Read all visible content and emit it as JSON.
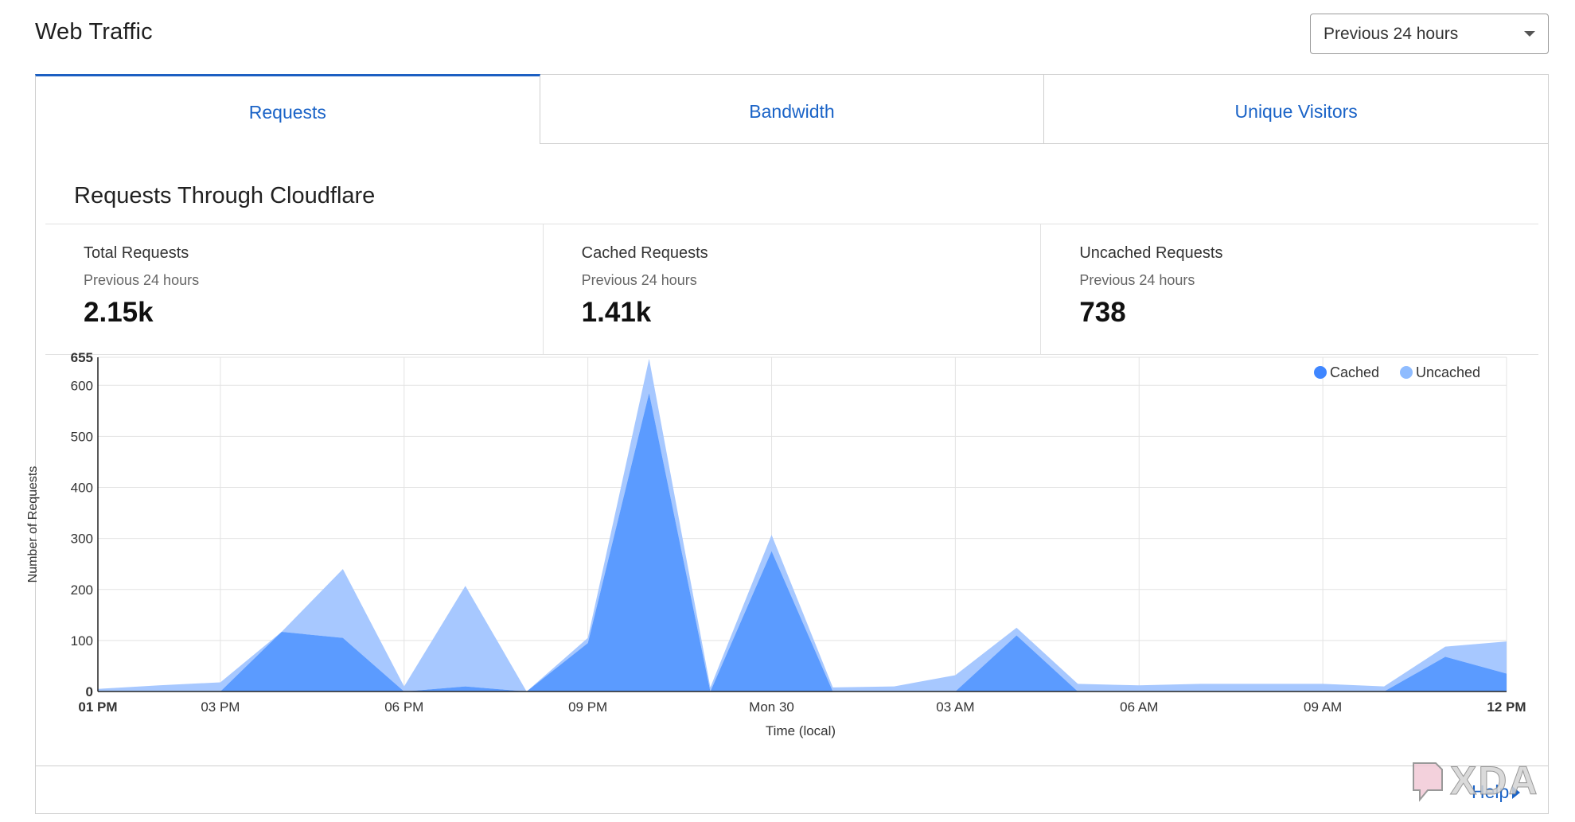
{
  "header": {
    "title": "Web Traffic",
    "range_select": {
      "selected": "Previous 24 hours"
    }
  },
  "tabs": [
    {
      "label": "Requests",
      "active": true
    },
    {
      "label": "Bandwidth",
      "active": false
    },
    {
      "label": "Unique Visitors",
      "active": false
    }
  ],
  "section": {
    "title": "Requests Through Cloudflare"
  },
  "stats": [
    {
      "label": "Total Requests",
      "sub": "Previous 24 hours",
      "value": "2.15k"
    },
    {
      "label": "Cached Requests",
      "sub": "Previous 24 hours",
      "value": "1.41k"
    },
    {
      "label": "Uncached Requests",
      "sub": "Previous 24 hours",
      "value": "738"
    }
  ],
  "chart_data": {
    "type": "area",
    "stacked": true,
    "ylabel": "Number of Requests",
    "xlabel": "Time (local)",
    "ylim": [
      0,
      655
    ],
    "yticks": [
      0,
      100,
      200,
      300,
      400,
      500,
      600,
      655
    ],
    "xlim": [
      0,
      23
    ],
    "xticks": [
      {
        "x": 0,
        "label": "01 PM",
        "bold": true
      },
      {
        "x": 2,
        "label": "03 PM"
      },
      {
        "x": 5,
        "label": "06 PM"
      },
      {
        "x": 8,
        "label": "09 PM"
      },
      {
        "x": 11,
        "label": "Mon 30"
      },
      {
        "x": 14,
        "label": "03 AM"
      },
      {
        "x": 17,
        "label": "06 AM"
      },
      {
        "x": 20,
        "label": "09 AM"
      },
      {
        "x": 23,
        "label": "12 PM",
        "bold": true
      }
    ],
    "grid": true,
    "legend": {
      "position": "top-right"
    },
    "x": [
      0,
      1,
      2,
      3,
      4,
      5,
      6,
      7,
      8,
      9,
      10,
      11,
      12,
      13,
      14,
      15,
      16,
      17,
      18,
      19,
      20,
      21,
      22,
      23
    ],
    "series": [
      {
        "name": "Cached",
        "color": "#5b9bff",
        "values": [
          0,
          0,
          0,
          117,
          105,
          0,
          10,
          0,
          95,
          585,
          0,
          275,
          0,
          0,
          0,
          110,
          0,
          0,
          0,
          0,
          0,
          0,
          68,
          35
        ]
      },
      {
        "name": "Uncached",
        "color": "#a7c8ff",
        "values": [
          5,
          12,
          18,
          0,
          135,
          10,
          197,
          0,
          10,
          67,
          8,
          32,
          8,
          10,
          32,
          15,
          15,
          12,
          15,
          15,
          15,
          10,
          20,
          63
        ]
      }
    ]
  },
  "footer": {
    "help_label": "Help"
  },
  "watermark": {
    "text": "XDA"
  }
}
